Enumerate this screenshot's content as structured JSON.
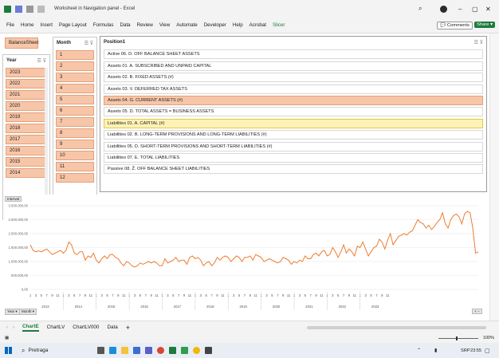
{
  "window": {
    "title": "Worksheet in Navigation panel - Excel"
  },
  "menu": [
    "File",
    "Home",
    "Insert",
    "Page Layout",
    "Formulas",
    "Data",
    "Review",
    "View",
    "Automate",
    "Developer",
    "Help",
    "Acrobat",
    "Slicer"
  ],
  "ribbon_right": {
    "comments": "Comments",
    "share": "Share"
  },
  "balance_button": "BalanceSheet",
  "year_slicer": {
    "title": "Year",
    "items": [
      "2023",
      "2022",
      "2021",
      "2020",
      "2019",
      "2018",
      "2017",
      "2016",
      "2015",
      "2014"
    ]
  },
  "month_slicer": {
    "title": "Month",
    "items": [
      "1",
      "2",
      "3",
      "4",
      "5",
      "6",
      "7",
      "8",
      "9",
      "10",
      "11",
      "12"
    ]
  },
  "position_slicer": {
    "title": "Position1",
    "items": [
      "Active 06. D. OFF BALANCE SHEET ASSETS",
      "Assets 01. A. SUBSCRIBED AND UNPAID CAPITAL",
      "Assets 02. B. FIXED ASSETS (#)",
      "Assets 03. V. DEFERRED TAX ASSETS",
      "Assets 04. G. CURRENT ASSETS (#)",
      "Assets 05. D. TOTAL ASSETS = BUSINESS ASSETS",
      "Liabilities 01. A. CAPITAL (#)",
      "Liabilities 02. B. LONG-TERM PROVISIONS AND LONG-TERM LIABILITIES (#)",
      "Liabilities 05. D. SHORT-TERM PROVISIONS AND SHORT-TERM LIABILITIES (#)",
      "Liabilities 07. E. TOTAL LIABILITIES",
      "Passive 08. Ž. OFF BALANCE SHEET LIABILITIES"
    ]
  },
  "chart_data": {
    "type": "line",
    "legend_button": "Interval",
    "y_ticks": [
      "3.000.000,00",
      "2.500.000,00",
      "2.000.000,00",
      "1.500.000,00",
      "1.000.000,00",
      "500.000,00",
      "0,00"
    ],
    "ylim": [
      0,
      3000000
    ],
    "month_ticks": [
      "1",
      "3",
      "5",
      "7",
      "9",
      "11"
    ],
    "years": [
      "2013",
      "2014",
      "2015",
      "2016",
      "2017",
      "2018",
      "2019",
      "2020",
      "2021",
      "2022",
      "2023"
    ],
    "series": [
      {
        "color": "#ed7d31",
        "values": [
          1600000,
          1400000,
          1350000,
          1380000,
          1350000,
          1400000,
          1450000,
          1350000,
          1250000,
          1300000,
          1350000,
          1400000,
          1300000,
          1400000,
          1700000,
          1600000,
          1300000,
          1250000,
          1350000,
          1350000,
          1050000,
          1200000,
          1150000,
          1300000,
          1050000,
          950000,
          1100000,
          1200000,
          1100000,
          1250000,
          1250000,
          1150000,
          1100000,
          950000,
          850000,
          1000000,
          950000,
          850000,
          800000,
          850000,
          950000,
          900000,
          950000,
          1000000,
          950000,
          1000000,
          950000,
          850000,
          850000,
          1100000,
          950000,
          1000000,
          1050000,
          1150000,
          1000000,
          1050000,
          1050000,
          900000,
          1150000,
          1200000,
          1100000,
          1150000,
          1050000,
          850000,
          950000,
          1000000,
          850000,
          950000,
          1150000,
          1050000,
          1150000,
          1200000,
          1150000,
          1000000,
          1100000,
          1200000,
          1150000,
          1000000,
          1150000,
          1150000,
          1200000,
          1050000,
          1250000,
          1200000,
          1150000,
          1000000,
          1050000,
          1100000,
          1050000,
          1000000,
          950000,
          1000000,
          1150000,
          1100000,
          1050000,
          900000,
          1000000,
          950000,
          1050000,
          1000000,
          1200000,
          1100000,
          1100000,
          1250000,
          1300000,
          1200000,
          1350000,
          1400000,
          1200000,
          1250000,
          1500000,
          1350000,
          1150000,
          1350000,
          1600000,
          1300000,
          1450000,
          1350000,
          1200000,
          1550000,
          1500000,
          1700000,
          1450000,
          1200000,
          1350000,
          1500000,
          1550000,
          1800000,
          1700000,
          1450000,
          1750000,
          2000000,
          1600000,
          1750000,
          1900000,
          1950000,
          2000000,
          1950000,
          2050000,
          2100000,
          2300000,
          2500000,
          2400000,
          2350000,
          2200000,
          2300000,
          2150000,
          2250000,
          2400000,
          2500000,
          2750000,
          2350000,
          2200000,
          2500000,
          2650000,
          2700000,
          2600000,
          2350000,
          2700000,
          2800000,
          2750000,
          2200000,
          1300000,
          1350000
        ]
      }
    ]
  },
  "chart_filters": [
    "Year",
    "Month"
  ],
  "sheet_tabs": [
    "ChartE",
    "ChartLV",
    "ChartLV000",
    "Data"
  ],
  "status": {
    "zoom": "100%"
  },
  "taskbar": {
    "search": "Pretraga",
    "lang": "SRP",
    "time": "23:55"
  }
}
